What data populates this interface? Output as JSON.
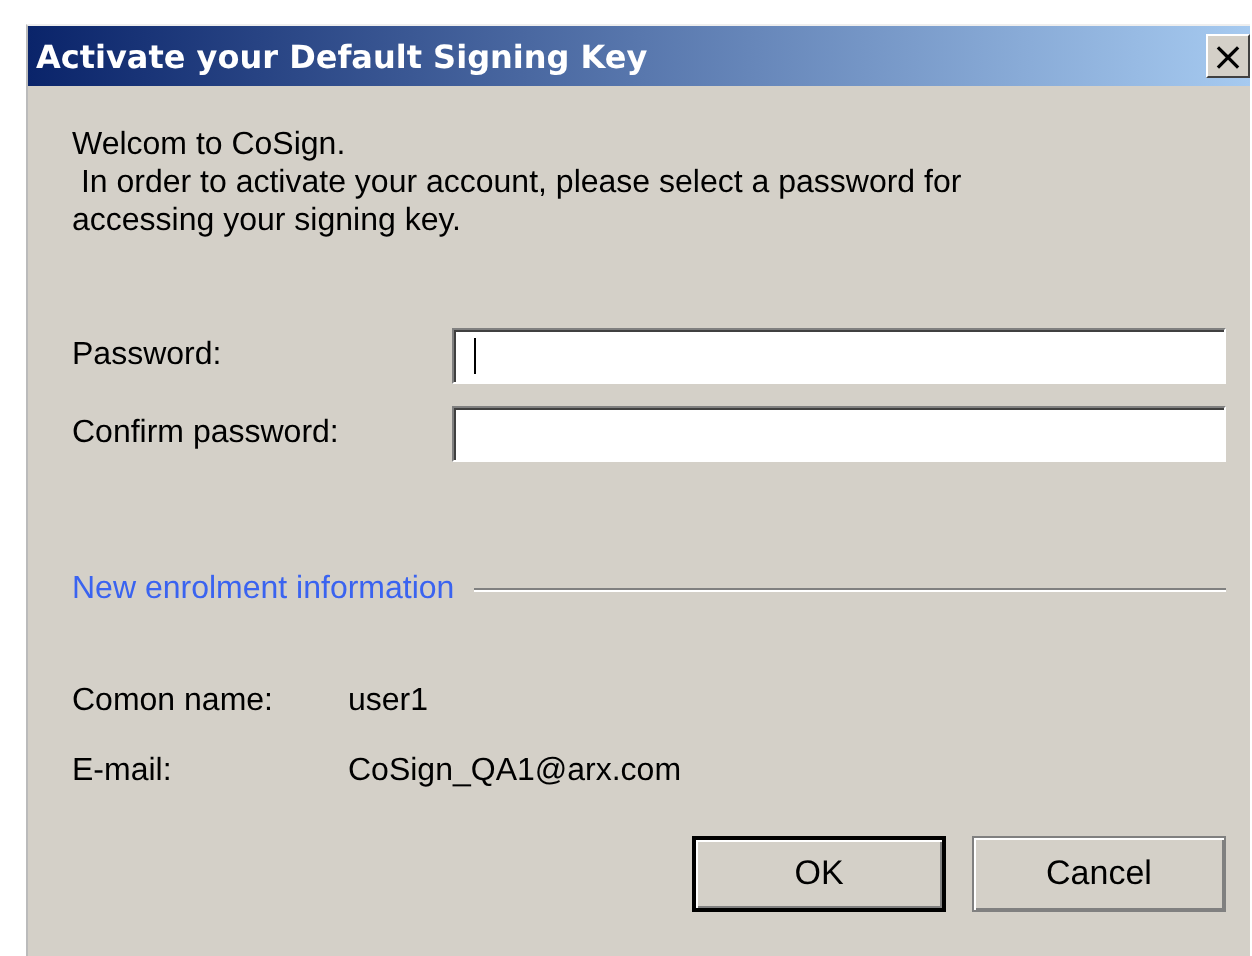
{
  "window": {
    "title": "Activate your Default Signing Key",
    "close_glyph": "×"
  },
  "intro": [
    "Welcom to CoSign.",
    " In order to activate your account, please select a password for accessing your signing key."
  ],
  "fields": [
    {
      "label": "Password:",
      "focused": true
    },
    {
      "label": "Confirm password:",
      "focused": false
    }
  ],
  "group": {
    "title": "New enrolment information"
  },
  "info": [
    {
      "label": "Comon name:",
      "value": "user1"
    },
    {
      "label": "E-mail:",
      "value": "CoSign_QA1@arx.com"
    }
  ],
  "buttons": [
    {
      "label": "OK",
      "default": true
    },
    {
      "label": "Cancel",
      "default": false
    }
  ]
}
